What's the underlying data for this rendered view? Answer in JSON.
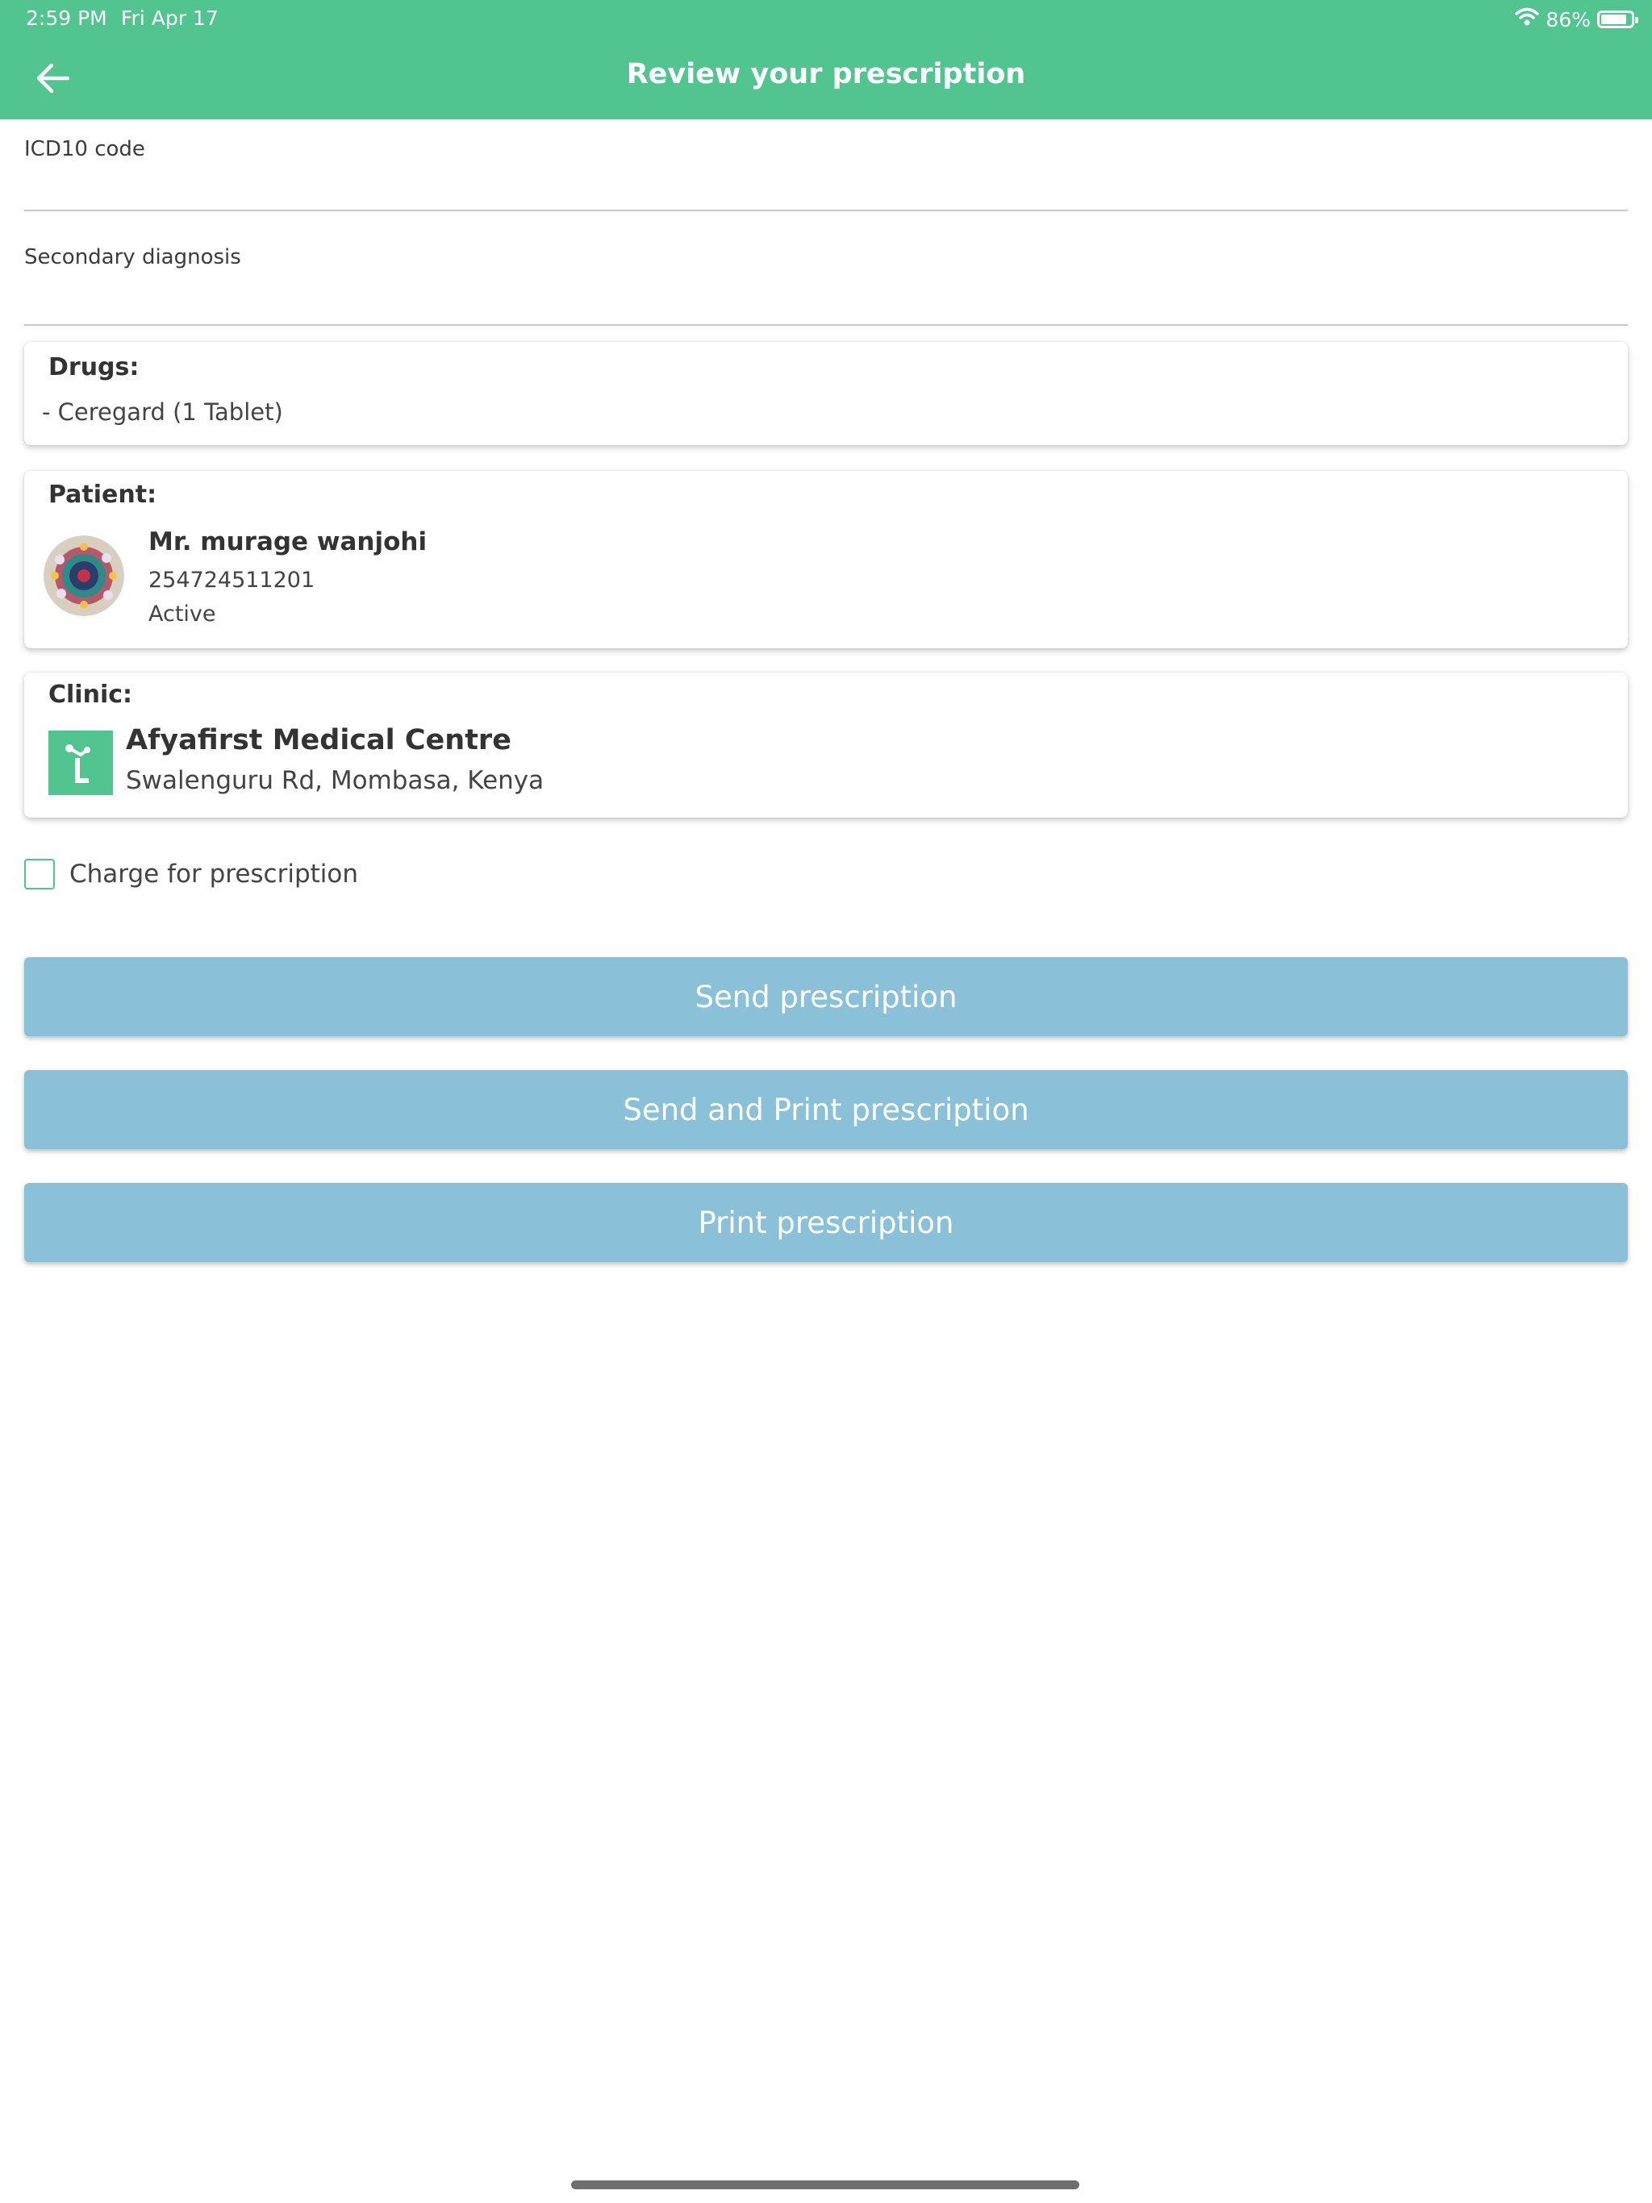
{
  "status_bar": {
    "time": "2:59 PM",
    "date": "Fri Apr 17",
    "battery_text": "86%",
    "battery_level": 0.86,
    "wifi_icon": "wifi-icon",
    "battery_icon": "battery-icon"
  },
  "header": {
    "title": "Review your prescription",
    "back_icon": "arrow-left-icon"
  },
  "form": {
    "icd10_label": "ICD10 code",
    "icd10_value": "",
    "secondary_label": "Secondary diagnosis",
    "secondary_value": ""
  },
  "drugs": {
    "heading": "Drugs:",
    "items": [
      "- Ceregard (1 Tablet)"
    ]
  },
  "patient": {
    "heading": "Patient:",
    "name": "Mr. murage wanjohi",
    "phone": "254724511201",
    "status": "Active"
  },
  "clinic": {
    "heading": "Clinic:",
    "name": "Afyafirst Medical Centre",
    "address": "Swalenguru Rd, Mombasa, Kenya"
  },
  "charge": {
    "label": "Charge for prescription",
    "checked": false
  },
  "buttons": {
    "send": "Send prescription",
    "send_print": "Send and Print prescription",
    "print": "Print prescription"
  },
  "colors": {
    "brand_green": "#52c48f",
    "button_blue": "#8ac1d9"
  }
}
